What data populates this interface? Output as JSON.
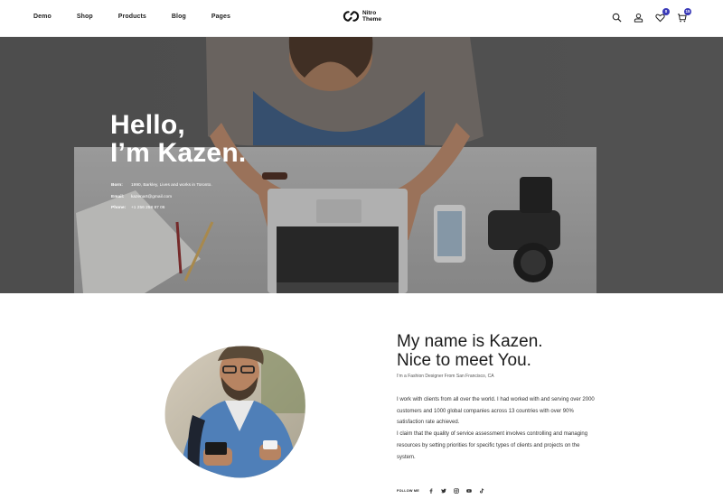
{
  "header": {
    "nav": [
      "Demo",
      "Shop",
      "Products",
      "Blog",
      "Pages"
    ],
    "logo": {
      "line1": "Nitro",
      "line2": "Theme"
    },
    "wishlist_count": "0",
    "cart_count": "15",
    "icons": [
      "search-icon",
      "user-icon",
      "heart-icon",
      "cart-icon"
    ]
  },
  "hero": {
    "title_line1": "Hello,",
    "title_line2": "I’m Kazen.",
    "info": [
      {
        "key": "Born:",
        "value": "1990, Barkley, Lives and works in Toronto."
      },
      {
        "key": "Email:",
        "value": "kazenart@gmail.com"
      },
      {
        "key": "Phone:",
        "value": "+1 256 258 87 06"
      }
    ]
  },
  "about": {
    "title_line1": "My name is Kazen.",
    "title_line2": "Nice to meet You.",
    "subtitle": "I’m a Fashion Designer From San Francisco, CA",
    "paragraph1": "I work with clients from all over the world. I had worked with and serving over 2000 customers and 1000 global companies across 13 countries with over 90% satisfaction rate achieved.",
    "paragraph2": "I claim that the quality of service assessment involves controlling and managing resources by setting priorities for specific types of clients and projects on the system.",
    "follow_label": "FOLLOW ME",
    "social": [
      "facebook-icon",
      "twitter-icon",
      "instagram-icon",
      "youtube-icon",
      "tiktok-icon"
    ]
  },
  "colors": {
    "accent": "#3a3ab8",
    "text": "#1a1a1a",
    "hero_bg": "#5b5b5b"
  }
}
